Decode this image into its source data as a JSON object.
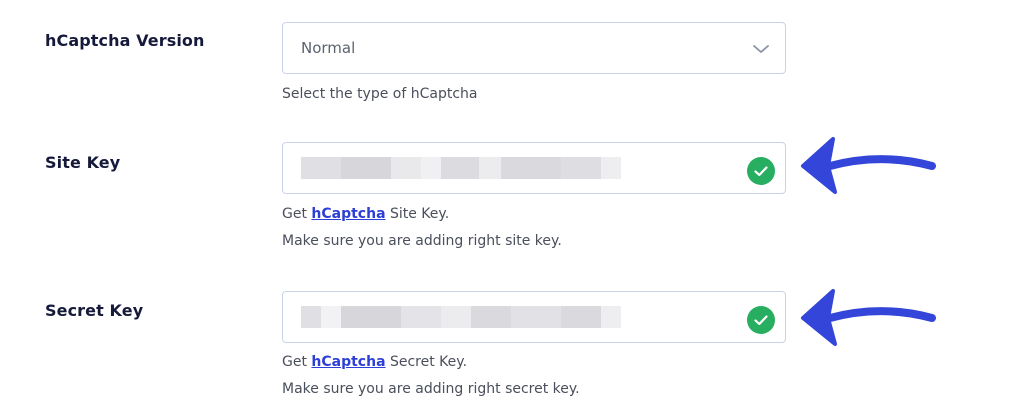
{
  "version": {
    "label": "hCaptcha Version",
    "selected": "Normal",
    "help": "Select the type of hCaptcha"
  },
  "site_key": {
    "label": "Site Key",
    "help_prefix": "Get ",
    "help_link": "hCaptcha",
    "help_suffix": " Site Key.",
    "help_line2": "Make sure you are adding right site key."
  },
  "secret_key": {
    "label": "Secret Key",
    "help_prefix": "Get ",
    "help_link": "hCaptcha",
    "help_suffix": " Secret Key.",
    "help_line2": "Make sure you are adding right secret key."
  },
  "colors": {
    "accent": "#3446d9",
    "success": "#27ae60",
    "border": "#c9d3e8"
  }
}
